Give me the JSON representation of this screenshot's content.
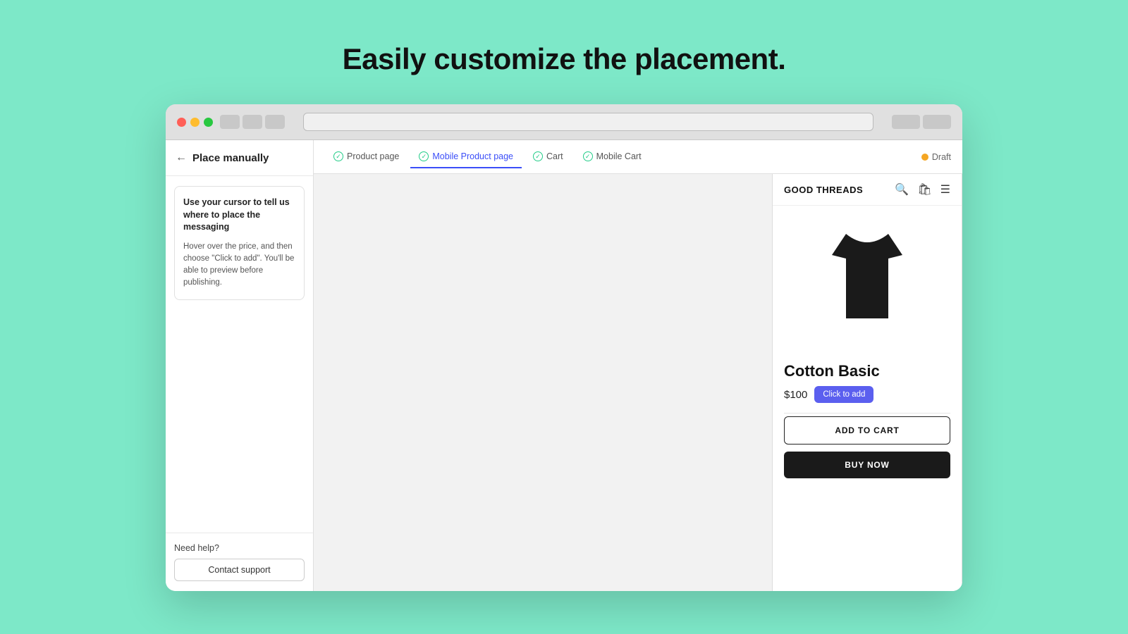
{
  "page": {
    "heading": "Easily customize the placement."
  },
  "browser": {
    "url_placeholder": ""
  },
  "sidebar": {
    "back_label": "‹",
    "title": "Place manually",
    "instruction_heading": "Use your cursor to tell us where to place the messaging",
    "instruction_body": "Hover over the price, and then choose \"Click to add\". You'll be able to preview before publishing.",
    "need_help_label": "Need help?",
    "contact_btn_label": "Contact support"
  },
  "tabs": {
    "items": [
      {
        "id": "product-page",
        "label": "Product page",
        "active": false
      },
      {
        "id": "mobile-product-page",
        "label": "Mobile Product page",
        "active": true
      },
      {
        "id": "cart",
        "label": "Cart",
        "active": false
      },
      {
        "id": "mobile-cart",
        "label": "Mobile Cart",
        "active": false
      }
    ],
    "draft_label": "Draft"
  },
  "product": {
    "store_name": "GOOD THREADS",
    "product_name": "Cotton Basic",
    "price": "$100",
    "click_to_add_label": "Click to add",
    "add_to_cart_label": "ADD TO CART",
    "buy_now_label": "BUY NOW"
  }
}
